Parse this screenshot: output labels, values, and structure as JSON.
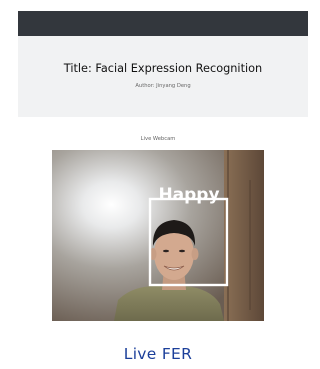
{
  "header": {
    "title": "Title: Facial Expression Recognition",
    "author": "Author: Jinyang Deng"
  },
  "webcam": {
    "label": "Live Webcam",
    "detected_emotion": "Happy"
  },
  "caption": "Live FER",
  "colors": {
    "topbar": "#33373d",
    "header_bg": "#f1f2f3",
    "caption": "#1b3f9a",
    "bbox": "#ffffff"
  }
}
